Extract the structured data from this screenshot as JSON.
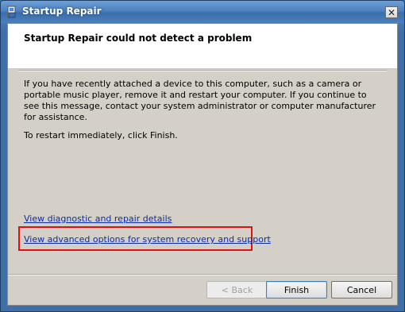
{
  "window": {
    "title": "Startup Repair",
    "close_glyph": "✕"
  },
  "header": {
    "title": "Startup Repair could not detect a problem"
  },
  "body": {
    "paragraph": "If you have recently attached a device to this computer, such as a camera or portable music player, remove it and restart your computer. If you continue to see this message, contact your system administrator or computer manufacturer for assistance.",
    "restart_hint": "To restart immediately, click Finish."
  },
  "links": {
    "diagnostic": "View diagnostic and repair details",
    "advanced": "View advanced options for system recovery and support"
  },
  "buttons": {
    "back": "< Back",
    "finish": "Finish",
    "cancel": "Cancel"
  },
  "colors": {
    "highlight": "#dd1111",
    "link": "#0a2ca8"
  }
}
